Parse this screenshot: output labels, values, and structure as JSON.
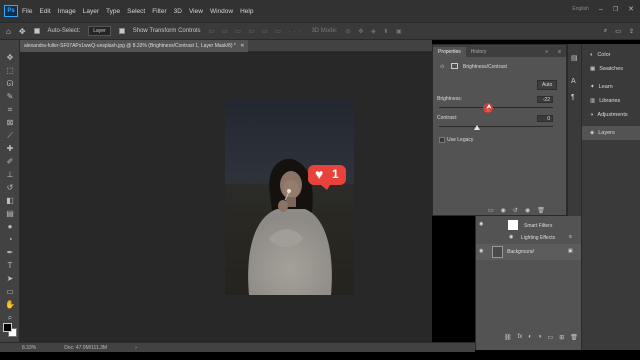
{
  "app": {
    "logo": "Ps",
    "menu": [
      "File",
      "Edit",
      "Image",
      "Layer",
      "Type",
      "Select",
      "Filter",
      "3D",
      "View",
      "Window",
      "Help"
    ],
    "language": "English"
  },
  "options_bar": {
    "auto_select_label": "Auto-Select:",
    "auto_select_value": "Layer",
    "show_transform_label": "Show Transform Controls",
    "mode_3d_label": "3D Mode:"
  },
  "document": {
    "tab_title": "alexandra-fuller-SF07APs1wwQ-unsplash.jpg @ 8.33% (Brightness/Contrast 1, Layer Mask/8) *",
    "zoom": "8.33%",
    "doc_size": "Doc: 47.0M/111.3M"
  },
  "photo_overlay": {
    "like_count": "1"
  },
  "properties": {
    "tab_active": "Properties",
    "tab_inactive": "History",
    "adjustment_title": "Brightness/Contrast",
    "auto_label": "Auto",
    "brightness_label": "Brightness:",
    "brightness_value": "-22",
    "brightness_level": -22,
    "contrast_label": "Contrast:",
    "contrast_value": "0",
    "contrast_level": 0,
    "legacy_label": "Use Legacy"
  },
  "layers": {
    "items": [
      {
        "name": "Smart Filters"
      },
      {
        "name": "Lighting Effects"
      },
      {
        "name": "Background"
      }
    ]
  },
  "dock": {
    "items": [
      "Color",
      "Swatches",
      "Learn",
      "Libraries",
      "Adjustments",
      "Layers"
    ]
  },
  "colors": {
    "accent": "#31a8ff",
    "like_badge": "#e8423c"
  }
}
